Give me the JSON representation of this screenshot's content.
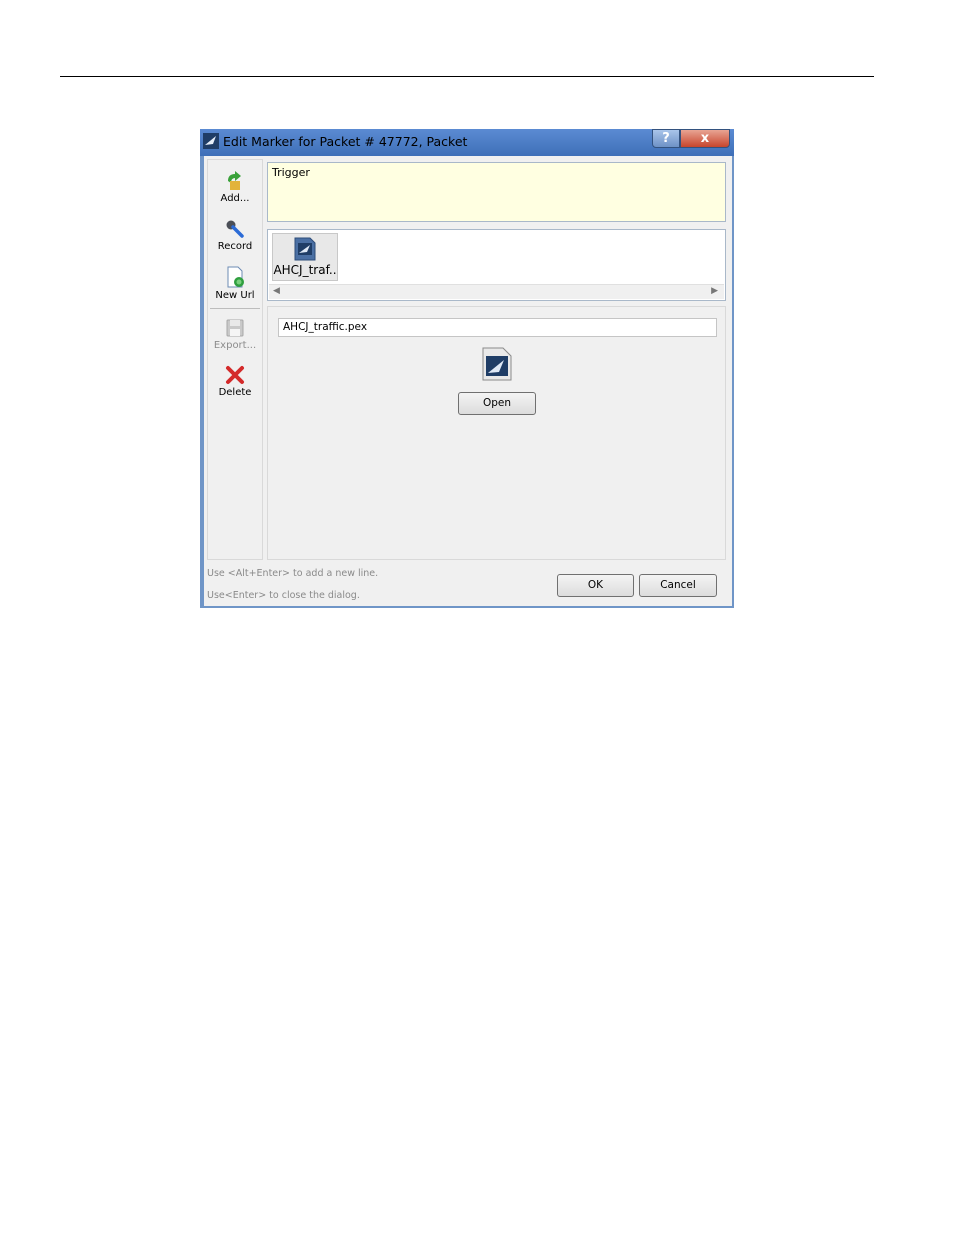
{
  "dialog": {
    "title": "Edit Marker for Packet # 47772, Packet",
    "help_label": "?",
    "close_label": "x"
  },
  "toolbar": {
    "add_label": "Add...",
    "record_label": "Record",
    "new_url_label": "New Url",
    "export_label": "Export...",
    "delete_label": "Delete"
  },
  "note": {
    "text": "Trigger"
  },
  "attachments": {
    "items": [
      {
        "label": "AHCJ_traf.."
      }
    ]
  },
  "detail": {
    "filename": "AHCJ_traffic.pex",
    "open_label": "Open"
  },
  "footer": {
    "hint_line1": "Use <Alt+Enter> to add a new line.",
    "hint_line2": "Use<Enter> to close the dialog.",
    "ok_label": "OK",
    "cancel_label": "Cancel"
  }
}
